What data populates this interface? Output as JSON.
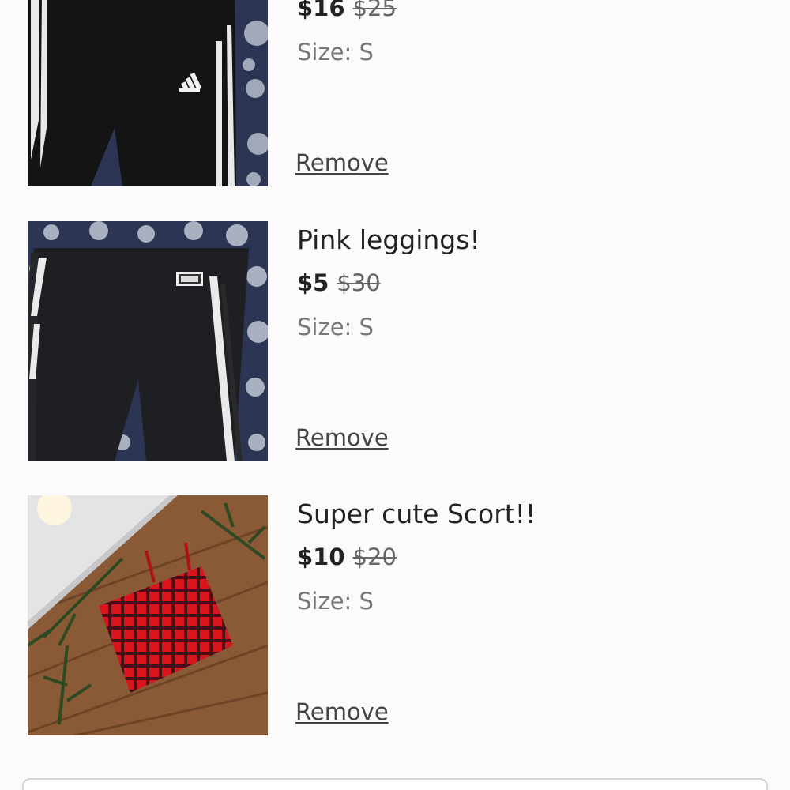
{
  "items": [
    {
      "title": "",
      "price": "$16",
      "original_price": "$25",
      "size_label": "Size:",
      "size": "S",
      "remove_label": "Remove",
      "image": "black adidas leggings on patterned blanket"
    },
    {
      "title": "Pink leggings!",
      "price": "$5",
      "original_price": "$30",
      "size_label": "Size:",
      "size": "S",
      "remove_label": "Remove",
      "image": "black PINK leggings on patterned blanket"
    },
    {
      "title": "Super cute Scort!!",
      "price": "$10",
      "original_price": "$20",
      "size_label": "Size:",
      "size": "S",
      "remove_label": "Remove",
      "image": "red plaid scort on wooden floor"
    }
  ],
  "colors": {
    "background": "#fcfafb",
    "text": "#222222",
    "muted": "#777777",
    "strike": "#666666"
  }
}
